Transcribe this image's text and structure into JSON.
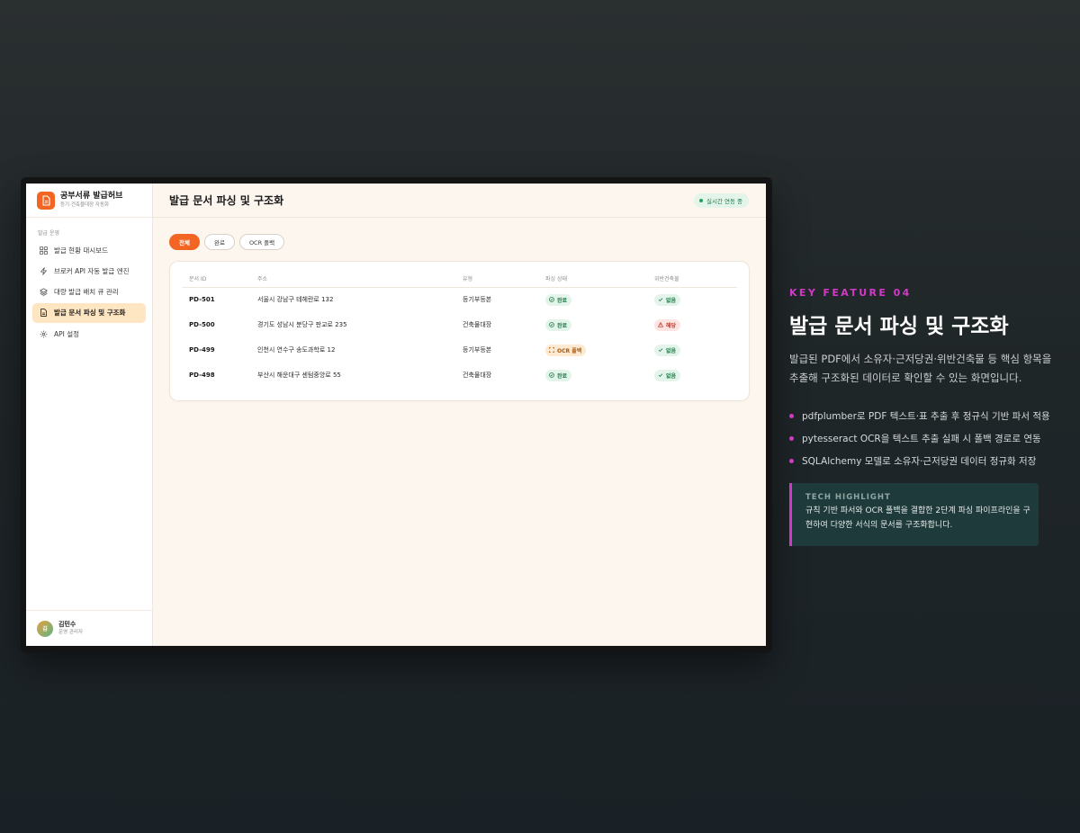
{
  "app": {
    "brand_title": "공부서류 발급허브",
    "brand_subtitle": "등기·건축물대장 자동화"
  },
  "sidebar": {
    "section_label": "발급 운영",
    "items": [
      {
        "label": "발급 현황 대시보드",
        "icon": "dashboard-grid-icon"
      },
      {
        "label": "브로커 API 자동 발급 엔진",
        "icon": "lightning-icon"
      },
      {
        "label": "대량 발급 배치 큐 관리",
        "icon": "layers-icon"
      },
      {
        "label": "발급 문서 파싱 및 구조화",
        "icon": "document-icon",
        "active": true
      },
      {
        "label": "API 설정",
        "icon": "gear-icon"
      }
    ],
    "user": {
      "avatar_initial": "김",
      "name": "김민수",
      "role": "운영 관리자"
    }
  },
  "header": {
    "title": "발급 문서 파싱 및 구조화",
    "live_status": "실시간 연동 중"
  },
  "filters": [
    {
      "label": "전체",
      "active": true
    },
    {
      "label": "완료",
      "active": false
    },
    {
      "label": "OCR 폴백",
      "active": false
    }
  ],
  "table": {
    "columns": [
      "문서 ID",
      "주소",
      "유형",
      "파싱 상태",
      "위반건축물"
    ],
    "rows": [
      {
        "id": "PD-501",
        "address": "서울시 강남구 테헤란로 132",
        "type": "등기부등본",
        "parse": "완료",
        "parse_kind": "green",
        "violation": "없음",
        "violation_kind": "green"
      },
      {
        "id": "PD-500",
        "address": "경기도 성남시 분당구 판교로 235",
        "type": "건축물대장",
        "parse": "완료",
        "parse_kind": "green",
        "violation": "해당",
        "violation_kind": "red"
      },
      {
        "id": "PD-499",
        "address": "인천시 연수구 송도과학로 12",
        "type": "등기부등본",
        "parse": "OCR 폴백",
        "parse_kind": "orange",
        "violation": "없음",
        "violation_kind": "green"
      },
      {
        "id": "PD-498",
        "address": "부산시 해운대구 센텀중앙로 55",
        "type": "건축물대장",
        "parse": "완료",
        "parse_kind": "green",
        "violation": "없음",
        "violation_kind": "green"
      }
    ]
  },
  "feature": {
    "kicker": "KEY FEATURE 04",
    "title": "발급 문서 파싱 및 구조화",
    "description": "발급된 PDF에서 소유자·근저당권·위반건축물 등 핵심 항목을 추출해 구조화된 데이터로 확인할 수 있는 화면입니다.",
    "bullets": [
      "pdfplumber로 PDF 텍스트·표 추출 후 정규식 기반 파서 적용",
      "pytesseract OCR을 텍스트 추출 실패 시 폴백 경로로 연동",
      "SQLAlchemy 모델로 소유자·근저당권 데이터 정규화 저장"
    ],
    "highlight_label": "TECH HIGHLIGHT",
    "highlight_text": "규칙 기반 파서와 OCR 폴백을 결합한 2단계 파싱 파이프라인을 구현하여 다양한 서식의 문서를 구조화합니다."
  },
  "colors": {
    "accent": "#f26522",
    "active_nav_bg": "#ffe6c2",
    "feature_accent": "#d438c8",
    "status_green": "#1e7a46",
    "status_red": "#c0392b",
    "status_orange": "#a85a12"
  }
}
